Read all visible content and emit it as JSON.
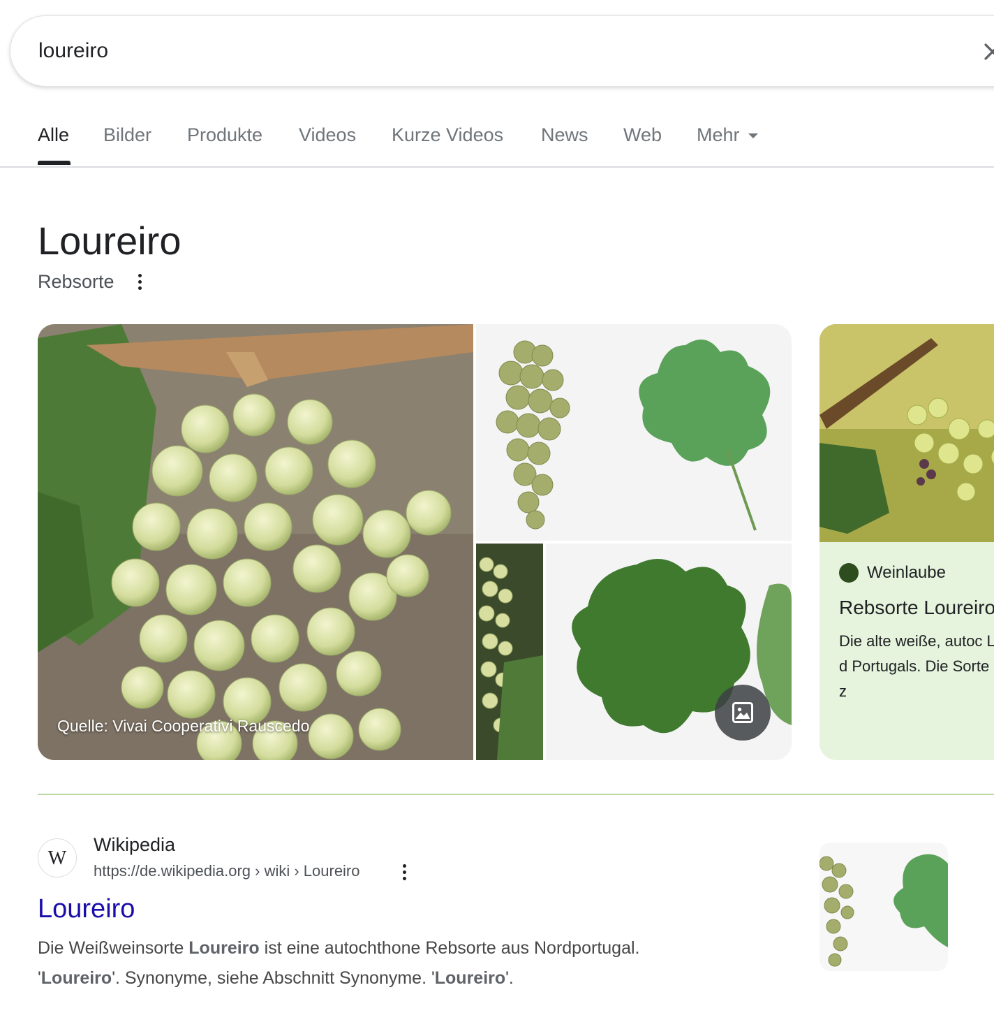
{
  "search": {
    "query": "loureiro"
  },
  "tabs": [
    {
      "label": "Alle"
    },
    {
      "label": "Bilder"
    },
    {
      "label": "Produkte"
    },
    {
      "label": "Videos"
    },
    {
      "label": "Kurze Videos"
    },
    {
      "label": "News"
    },
    {
      "label": "Web"
    },
    {
      "label": "Mehr"
    }
  ],
  "knowledge": {
    "title": "Loureiro",
    "subtitle": "Rebsorte",
    "image_caption": "Quelle: Vivai Cooperativi Rauscedo",
    "card": {
      "source": "Weinlaube",
      "title": "Rebsorte Loureiro",
      "text": "Die alte weiße, autoc Loureiro kommt aus d Portugals. Die Sorte und auf den Azoren z"
    }
  },
  "result": {
    "site_name": "Wikipedia",
    "favicon_letter": "W",
    "url": "https://de.wikipedia.org › wiki › Loureiro",
    "title": "Loureiro",
    "snippet": {
      "s1": "Die Weißweinsorte ",
      "b1": "Loureiro",
      "s2": " ist eine autochthone Rebsorte aus Nordportugal.",
      "s3": "'",
      "b2": "Loureiro",
      "s4": "'. Synonyme, siehe Abschnitt Synonyme. '",
      "b3": "Loureiro",
      "s5": "'."
    }
  },
  "colors": {
    "link": "#1a0dab",
    "card_bg": "#e6f4dd",
    "divider": "#bcd9a8"
  }
}
